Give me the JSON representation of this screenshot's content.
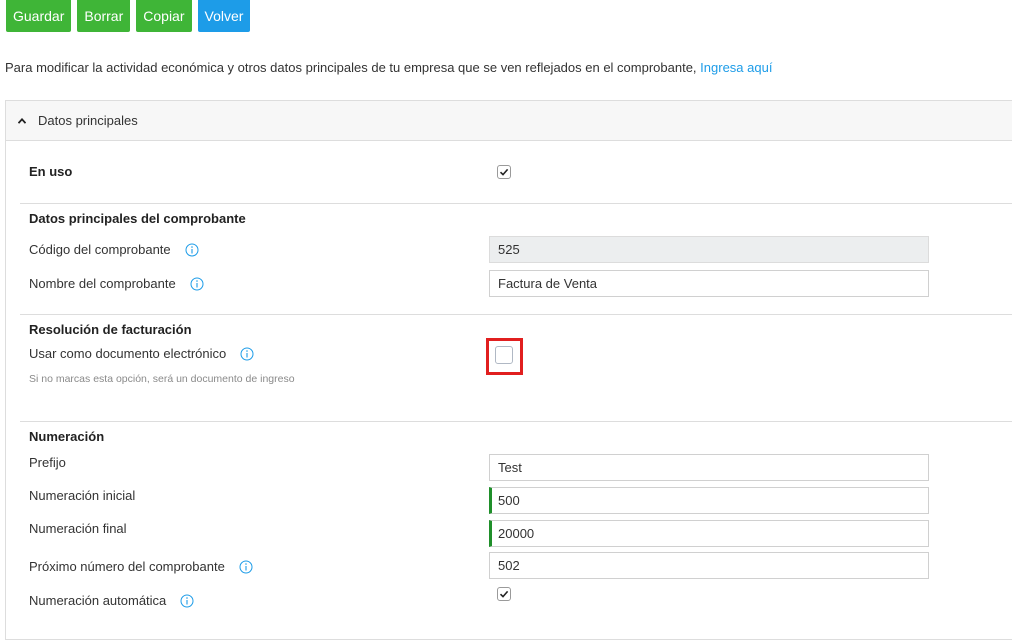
{
  "toolbar": {
    "save": "Guardar",
    "delete": "Borrar",
    "copy": "Copiar",
    "back": "Volver"
  },
  "intro": {
    "text": "Para modificar la actividad económica y otros datos principales de tu empresa que se ven reflejados en el comprobante, ",
    "link": "Ingresa aquí"
  },
  "panel": {
    "title": "Datos principales"
  },
  "in_use": {
    "label": "En uso",
    "checked": true
  },
  "main_data": {
    "heading": "Datos principales del comprobante",
    "code_label": "Código del comprobante",
    "code_value": "525",
    "name_label": "Nombre del comprobante",
    "name_value": "Factura de Venta"
  },
  "resolution": {
    "heading": "Resolución de facturación",
    "electronic_label": "Usar como documento electrónico",
    "electronic_checked": false,
    "hint": "Si no marcas esta opción, será un documento de ingreso"
  },
  "numbering": {
    "heading": "Numeración",
    "prefix_label": "Prefijo",
    "prefix_value": "Test",
    "initial_label": "Numeración inicial",
    "initial_value": "500",
    "final_label": "Numeración final",
    "final_value": "20000",
    "next_label": "Próximo número del comprobante",
    "next_value": "502",
    "auto_label": "Numeración automática",
    "auto_checked": true
  },
  "colors": {
    "green_button": "#3fb537",
    "blue_button": "#1d9ce8",
    "link": "#1d9ce8",
    "highlight": "#e11f1f",
    "valid_indicator": "#1f8f2a"
  }
}
